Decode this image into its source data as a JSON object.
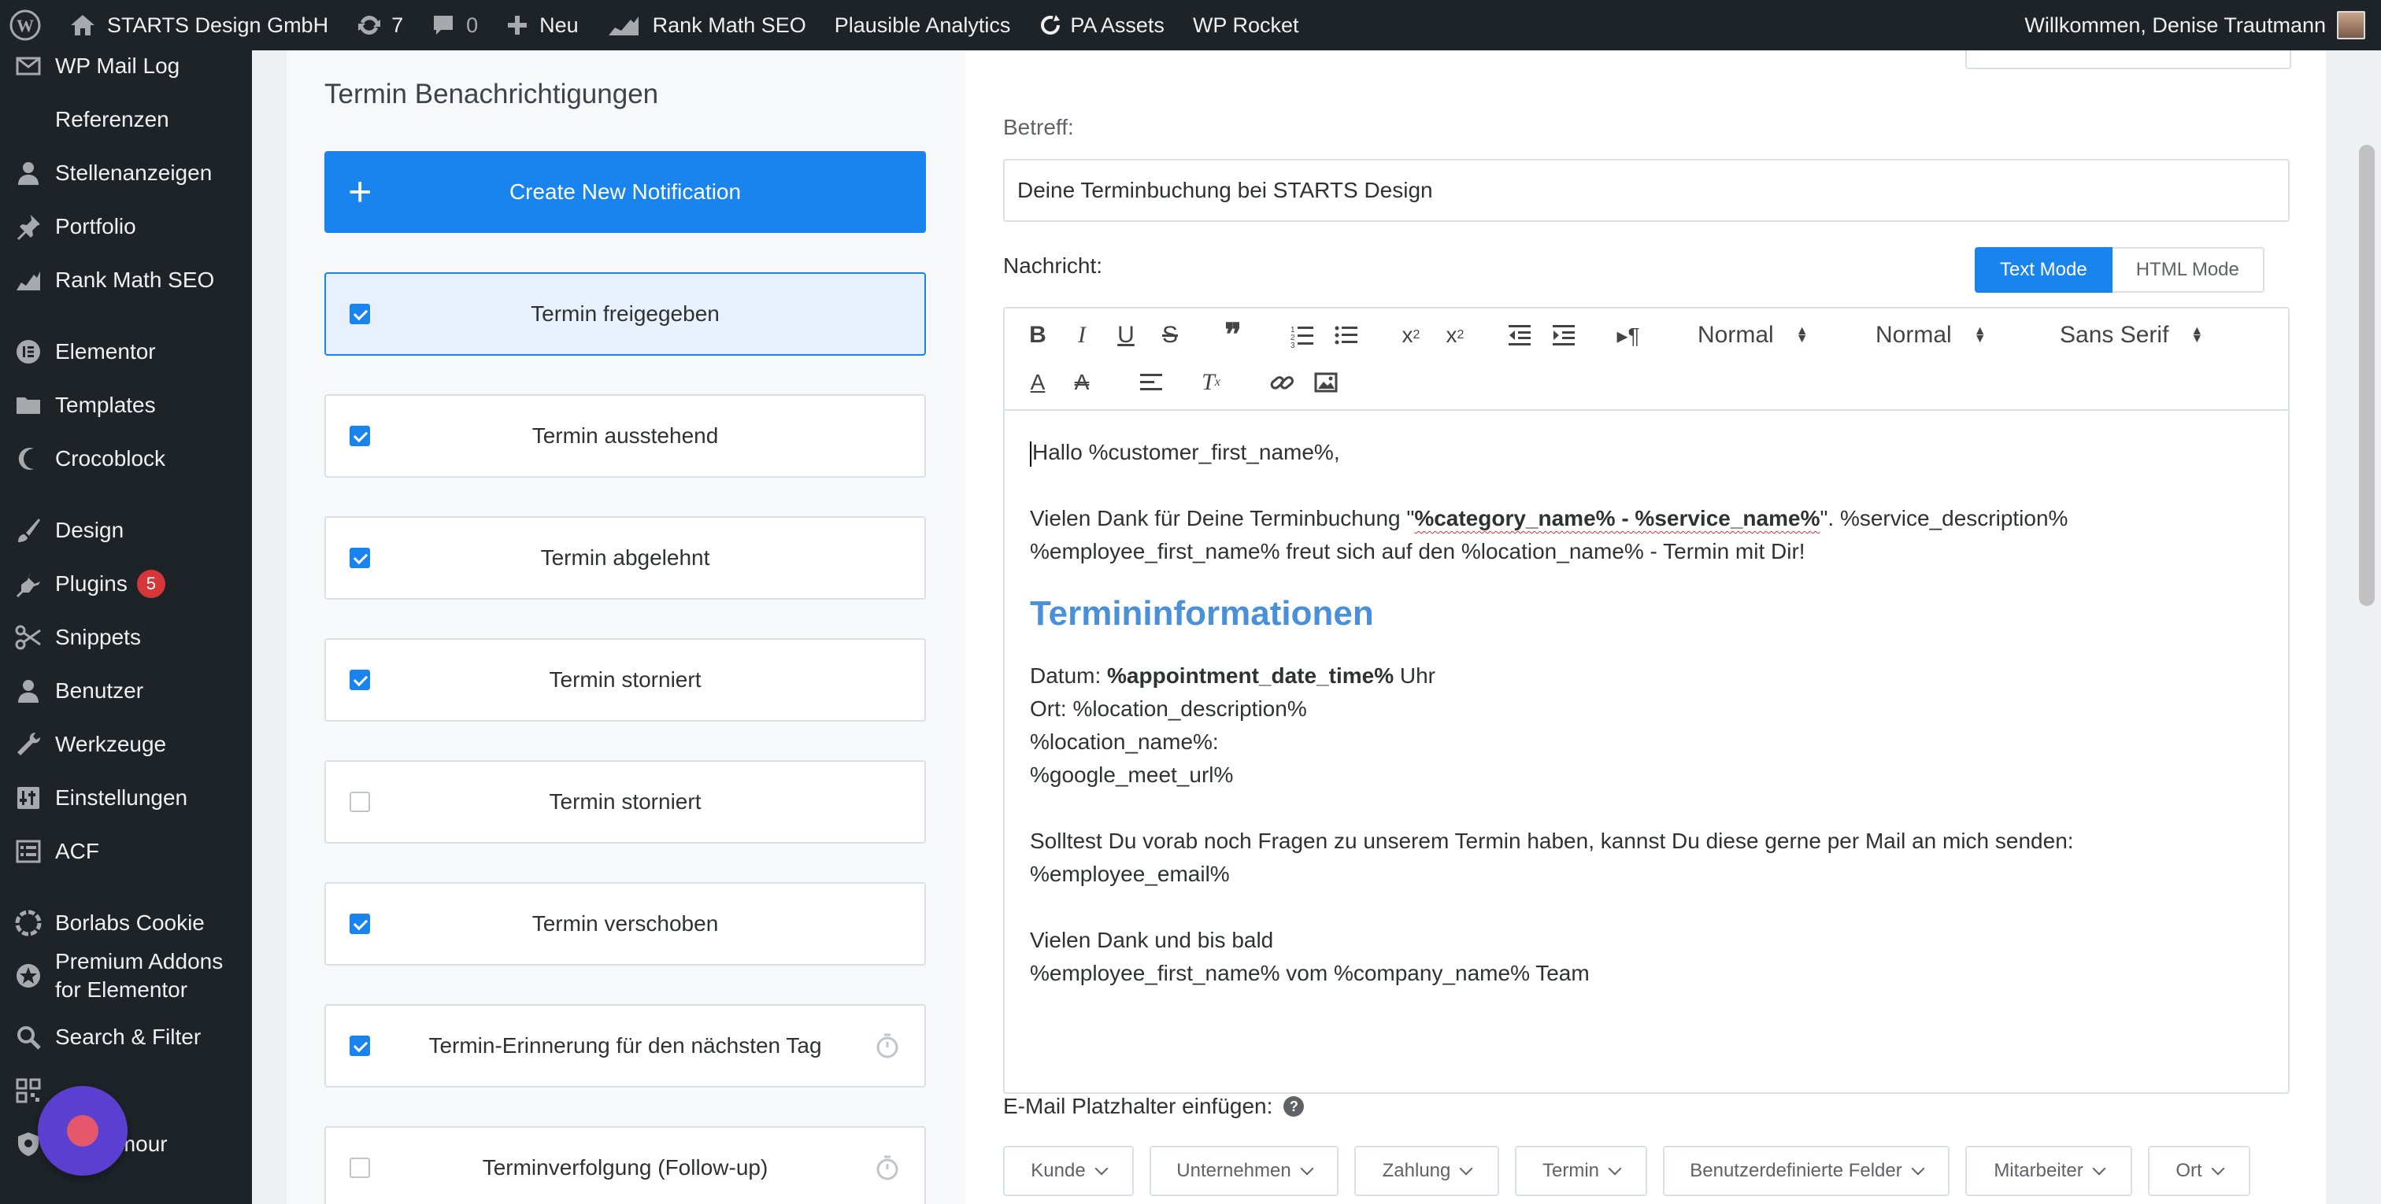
{
  "adminbar": {
    "site_name": "STARTS Design GmbH",
    "updates_count": "7",
    "comments_count": "0",
    "new_label": "Neu",
    "rankmath_label": "Rank Math SEO",
    "plausible_label": "Plausible Analytics",
    "pa_assets_label": "PA Assets",
    "wprocket_label": "WP Rocket",
    "greeting": "Willkommen, Denise Trautmann"
  },
  "sidebar": {
    "items": [
      {
        "label": "WP Mail Log",
        "icon": "mail-icon"
      },
      {
        "label": "Referenzen",
        "icon": "admin-generic-icon"
      },
      {
        "label": "Stellenanzeigen",
        "icon": "user-icon"
      },
      {
        "label": "Portfolio",
        "icon": "pin-icon"
      },
      {
        "label": "Rank Math SEO",
        "icon": "rankmath-icon"
      },
      {
        "label": "Elementor",
        "icon": "elementor-icon"
      },
      {
        "label": "Templates",
        "icon": "folder-icon"
      },
      {
        "label": "Crocoblock",
        "icon": "crocoblock-icon"
      },
      {
        "label": "Design",
        "icon": "brush-icon"
      },
      {
        "label": "Plugins",
        "icon": "plugin-icon",
        "badge": "5"
      },
      {
        "label": "Snippets",
        "icon": "scissors-icon"
      },
      {
        "label": "Benutzer",
        "icon": "user-icon"
      },
      {
        "label": "Werkzeuge",
        "icon": "wrench-icon"
      },
      {
        "label": "Einstellungen",
        "icon": "settings-icon"
      },
      {
        "label": "ACF",
        "icon": "list-icon"
      },
      {
        "label": "Borlabs Cookie",
        "icon": "cookie-icon"
      },
      {
        "label": "Premium Addons for Elementor",
        "icon": "premium-addons-icon"
      },
      {
        "label": "Search & Filter",
        "icon": "search-icon"
      },
      {
        "label": "",
        "icon": "qr-icon"
      },
      {
        "label": "WP Armour",
        "icon": "shield-icon"
      }
    ]
  },
  "notifications": {
    "title": "Termin Benachrichtigungen",
    "create_label": "Create New Notification",
    "items": [
      {
        "label": "Termin freigegeben",
        "checked": true
      },
      {
        "label": "Termin ausstehend",
        "checked": true
      },
      {
        "label": "Termin abgelehnt",
        "checked": true
      },
      {
        "label": "Termin storniert",
        "checked": true
      },
      {
        "label": "Termin storniert",
        "checked": false
      },
      {
        "label": "Termin verschoben",
        "checked": true
      },
      {
        "label": "Termin-Erinnerung für den nächsten Tag",
        "checked": true
      },
      {
        "label": "Terminverfolgung (Follow-up)",
        "checked": false
      }
    ]
  },
  "form": {
    "subject_label": "Betreff:",
    "subject_value": "Deine Terminbuchung bei STARTS Design",
    "message_label": "Nachricht:",
    "text_mode": "Text Mode",
    "html_mode": "HTML Mode",
    "toolbar": {
      "header_select": "Normal",
      "size_select": "Normal",
      "font_select": "Sans Serif"
    },
    "body": {
      "greeting": "Hallo %customer_first_name%,",
      "line1_pre": "Vielen Dank für Deine Terminbuchung \"",
      "line1_bold": "%category_name% - %service_name%",
      "line1_post": "\". %service_description%",
      "line2": "%employee_first_name% freut sich auf den %location_name% - Termin mit Dir!",
      "heading": "Termininformationen",
      "date_pre": "Datum: ",
      "date_bold": "%appointment_date_time%",
      "date_post": " Uhr",
      "place": "Ort: %location_description%",
      "location_name": "%location_name%:",
      "meet_url": "%google_meet_url%",
      "questions": "Solltest Du vorab noch Fragen zu unserem Termin haben, kannst Du diese gerne per Mail an mich senden:",
      "employee_email": "%employee_email%",
      "thanks": "Vielen Dank und bis bald",
      "signature": "%employee_first_name% vom %company_name% Team"
    },
    "placeholders_label": "E-Mail Platzhalter einfügen:",
    "placeholder_buttons": [
      "Kunde",
      "Unternehmen",
      "Zahlung",
      "Termin",
      "Benutzerdefinierte Felder",
      "Mitarbeiter",
      "Ort"
    ]
  },
  "colors": {
    "accent": "#1a84ee",
    "admin_bg": "#1d2327",
    "heading_blue": "#4a90d9",
    "badge_red": "#d63638"
  }
}
